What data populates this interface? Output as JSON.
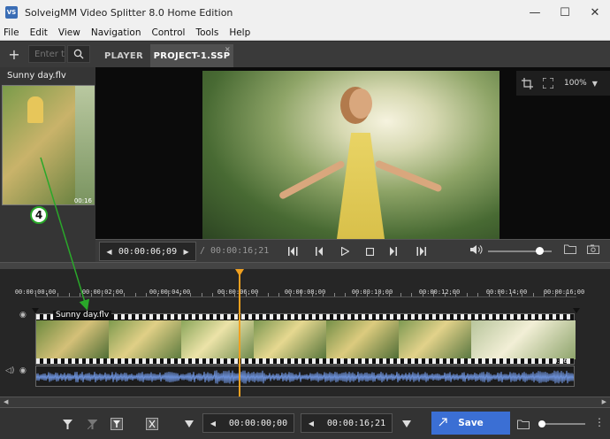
{
  "window": {
    "title": "SolveigMM Video Splitter 8.0 Home Edition",
    "minimize": "—",
    "maximize": "☐",
    "close": "✕"
  },
  "menu": [
    "File",
    "Edit",
    "View",
    "Navigation",
    "Control",
    "Tools",
    "Help"
  ],
  "toolbar": {
    "add_label": "+",
    "search_placeholder": "Enter t",
    "tabs": [
      "PLAYER",
      "PROJECT-1.SSP"
    ],
    "tab_close": "×"
  },
  "media_list": {
    "file_name": "Sunny day.flv",
    "thumb_time": "00:16"
  },
  "step_marker": "4",
  "viewer": {
    "zoom": "100%"
  },
  "transport": {
    "current_time": "00:00:06;09",
    "total_time": "/ 00:00:16;21",
    "volume": 0.8
  },
  "timeline": {
    "tick_labels": [
      "00:00:00;00",
      "00:00:02;00",
      "00:00:04;00",
      "00:00:06;00",
      "00:00:08;00",
      "00:00:10;00",
      "00:00:12;00",
      "00:00:14;00",
      "00:00:16;00"
    ],
    "clip_label": "Sunny day.flv",
    "clip_end_time": "0:16",
    "playhead_seconds": 6.3,
    "duration_seconds": 16.7
  },
  "bottom": {
    "start_time": "00:00:00;00",
    "end_time": "00:00:16;21",
    "save_label": "Save"
  },
  "colors": {
    "accent": "#3b6fd4",
    "playhead": "#f0a020",
    "annotation": "#2aa82a",
    "waveform": "#6b8fd6"
  }
}
